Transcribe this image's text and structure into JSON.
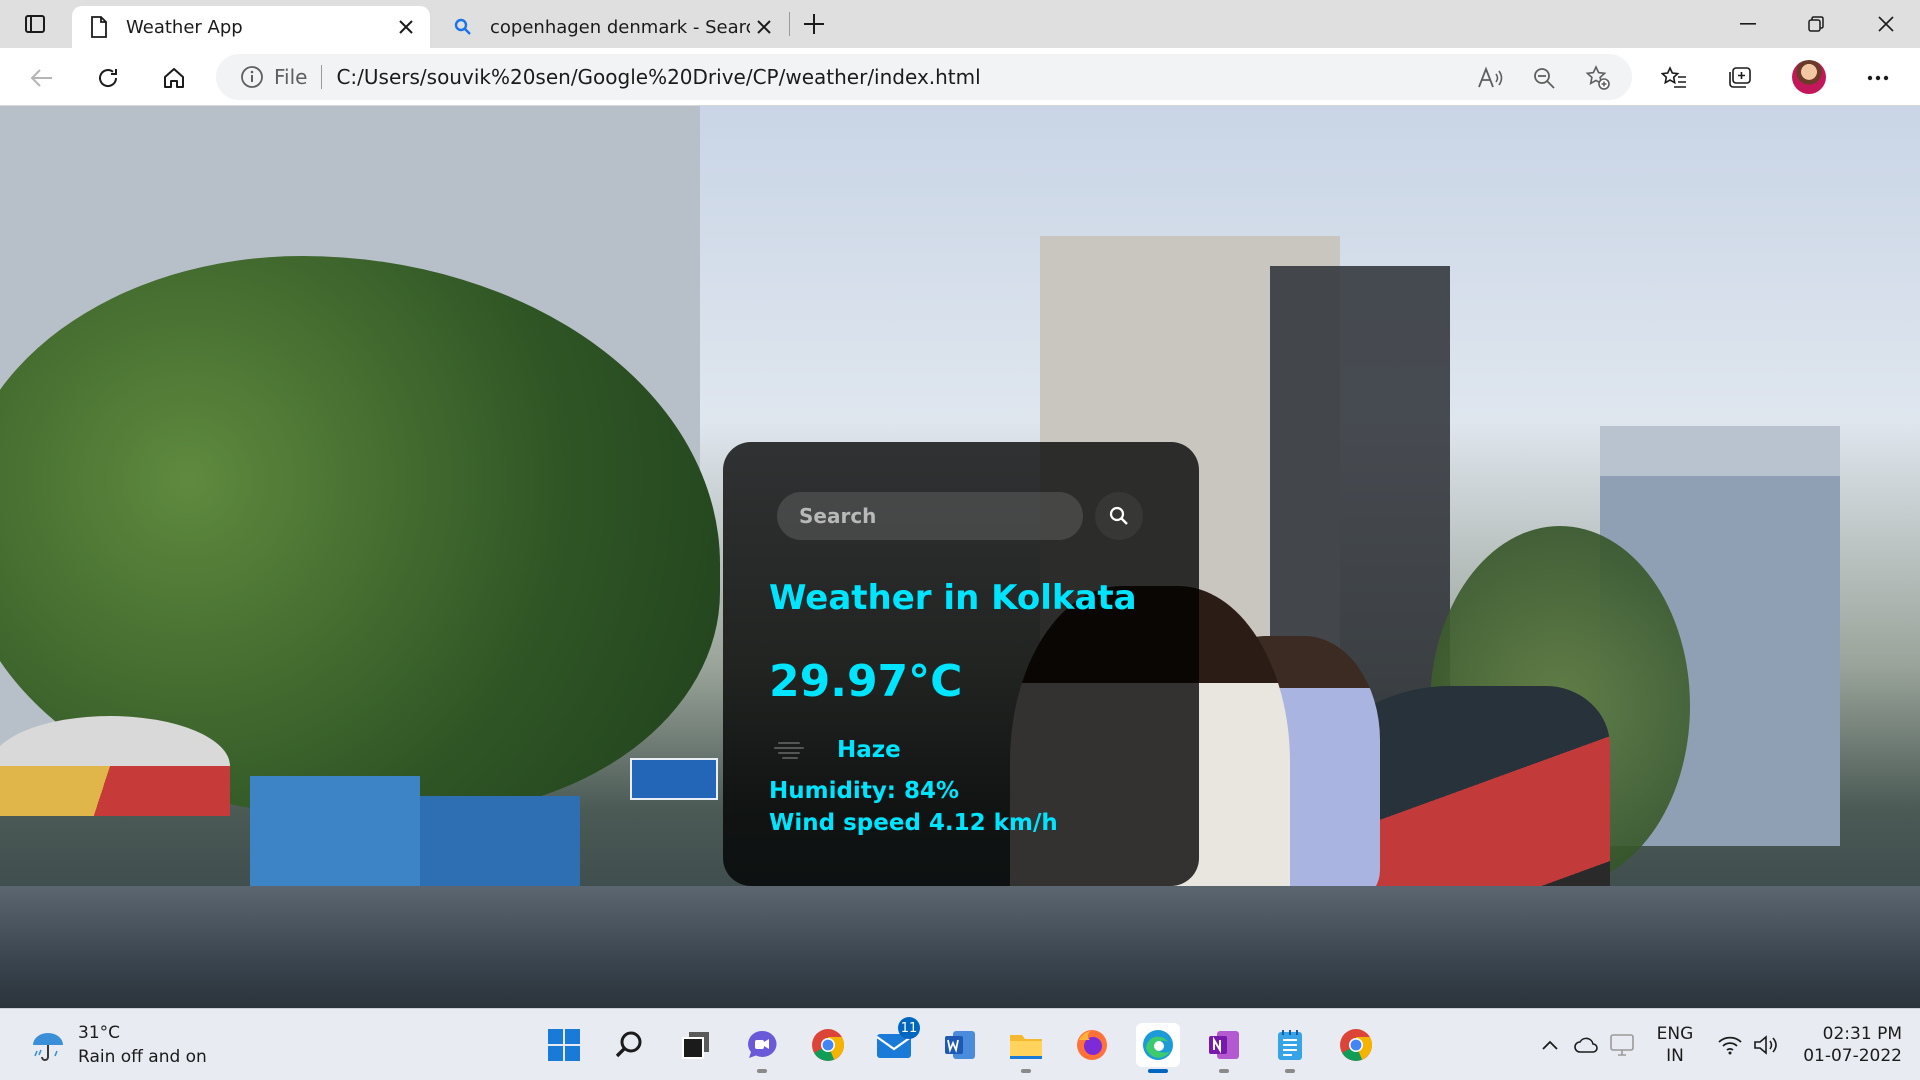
{
  "browser": {
    "tabs": [
      {
        "title": "Weather App",
        "active": true,
        "icon": "page-icon"
      },
      {
        "title": "copenhagen denmark - Search",
        "active": false,
        "icon": "search-icon"
      }
    ],
    "address": {
      "scheme": "File",
      "url": "C:/Users/souvik%20sen/Google%20Drive/CP/weather/index.html"
    }
  },
  "weather_card": {
    "search_placeholder": "Search",
    "city_heading": "Weather in Kolkata",
    "temperature": "29.97°C",
    "condition": "Haze",
    "humidity": "Humidity: 84%",
    "wind": "Wind speed 4.12 km/h",
    "accent_color": "#00e5ff"
  },
  "taskbar": {
    "weather": {
      "temp": "31°C",
      "desc": "Rain off and on"
    },
    "mail_badge": "11",
    "language": {
      "line1": "ENG",
      "line2": "IN"
    },
    "clock": {
      "time": "02:31 PM",
      "date": "01-07-2022"
    }
  }
}
